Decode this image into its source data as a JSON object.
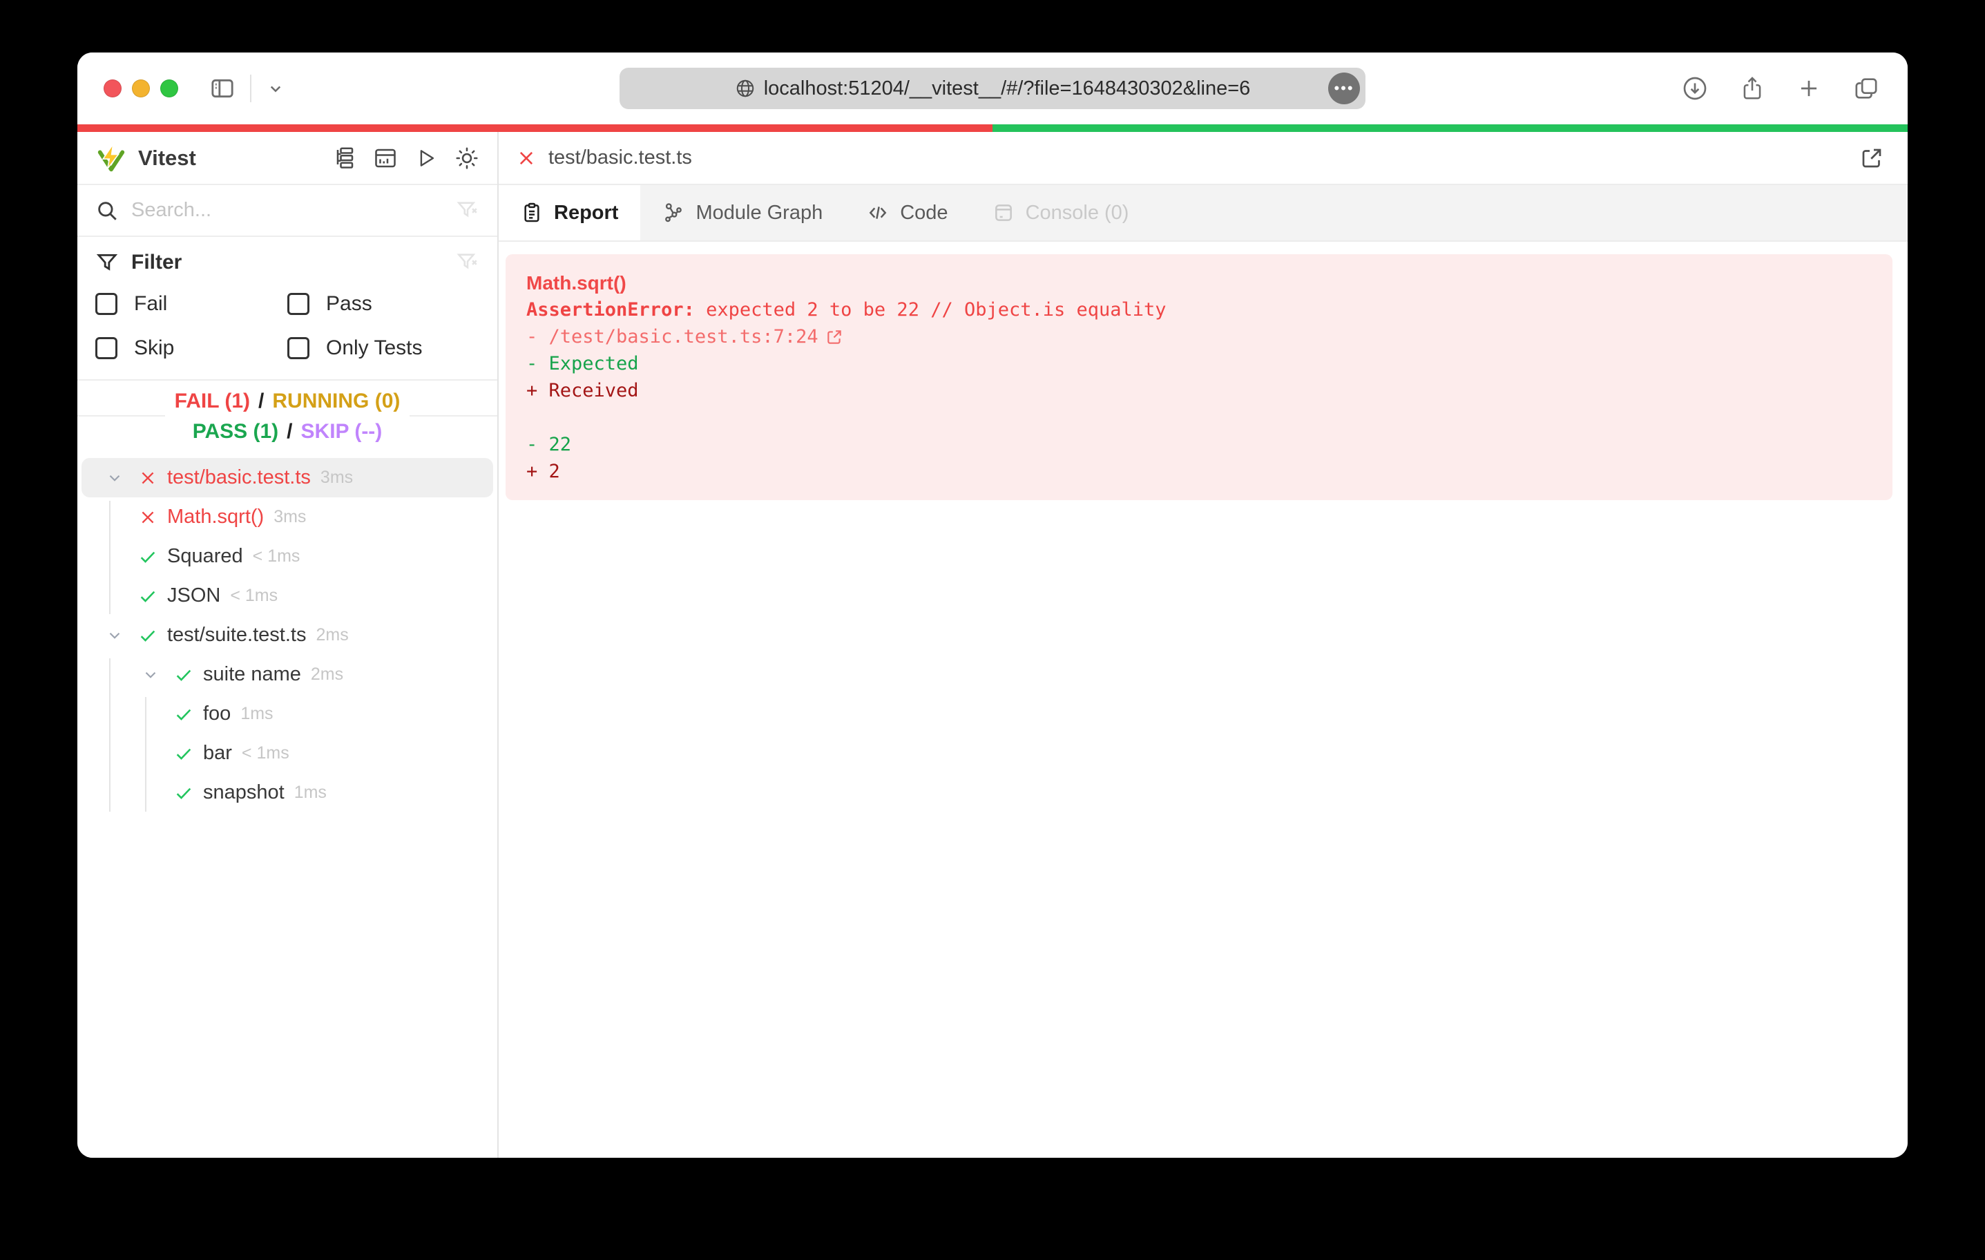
{
  "browser": {
    "url": "localhost:51204/__vitest__/#/?file=1648430302&line=6",
    "more_dots": "•••"
  },
  "progress": {
    "fail_fraction": 0.5,
    "pass_fraction": 0.5,
    "fail_color": "#ef4444",
    "pass_color": "#24c35c"
  },
  "sidebar": {
    "app_title": "Vitest",
    "search": {
      "placeholder": "Search..."
    },
    "filter": {
      "title": "Filter",
      "options": [
        {
          "label": "Fail",
          "checked": false
        },
        {
          "label": "Pass",
          "checked": false
        },
        {
          "label": "Skip",
          "checked": false
        },
        {
          "label": "Only Tests",
          "checked": false
        }
      ]
    },
    "summary": {
      "fail": "FAIL (1)",
      "sep1": "/",
      "running": "RUNNING (0)",
      "pass": "PASS (1)",
      "sep2": "/",
      "skip": "SKIP (--)",
      "colors": {
        "fail": "#ef4444",
        "running": "#d4a017",
        "pass": "#1aa64f",
        "skip": "#c084fc"
      }
    },
    "tree": [
      {
        "label": "test/basic.test.ts",
        "duration": "3ms",
        "status": "fail",
        "level": 0,
        "expandable": true,
        "selected": true
      },
      {
        "label": "Math.sqrt()",
        "duration": "3ms",
        "status": "fail",
        "level": 1,
        "expandable": false,
        "selected": false
      },
      {
        "label": "Squared",
        "duration": "< 1ms",
        "status": "pass",
        "level": 1,
        "expandable": false,
        "selected": false
      },
      {
        "label": "JSON",
        "duration": "< 1ms",
        "status": "pass",
        "level": 1,
        "expandable": false,
        "selected": false
      },
      {
        "label": "test/suite.test.ts",
        "duration": "2ms",
        "status": "pass",
        "level": 0,
        "expandable": true,
        "selected": false
      },
      {
        "label": "suite name",
        "duration": "2ms",
        "status": "pass",
        "level": 1,
        "expandable": true,
        "selected": false
      },
      {
        "label": "foo",
        "duration": "1ms",
        "status": "pass",
        "level": 2,
        "expandable": false,
        "selected": false
      },
      {
        "label": "bar",
        "duration": "< 1ms",
        "status": "pass",
        "level": 2,
        "expandable": false,
        "selected": false
      },
      {
        "label": "snapshot",
        "duration": "1ms",
        "status": "pass",
        "level": 2,
        "expandable": false,
        "selected": false
      }
    ]
  },
  "main": {
    "file_tab": "test/basic.test.ts",
    "tabs": [
      {
        "label": "Report",
        "active": true,
        "disabled": false
      },
      {
        "label": "Module Graph",
        "active": false,
        "disabled": false
      },
      {
        "label": "Code",
        "active": false,
        "disabled": false
      },
      {
        "label": "Console (0)",
        "active": false,
        "disabled": true
      }
    ],
    "error": {
      "test_name": "Math.sqrt()",
      "error_name": "AssertionError: ",
      "message": "expected 2 to be 22 // Object.is equality",
      "location": "- /test/basic.test.ts:7:24",
      "diff_label_expected": "- Expected",
      "diff_label_received": "+ Received",
      "diff_expected_value": "- 22",
      "diff_received_value": "+ 2",
      "panel_bg": "#fdecec",
      "expected_color": "#16a34a",
      "received_color": "#a31515"
    }
  }
}
